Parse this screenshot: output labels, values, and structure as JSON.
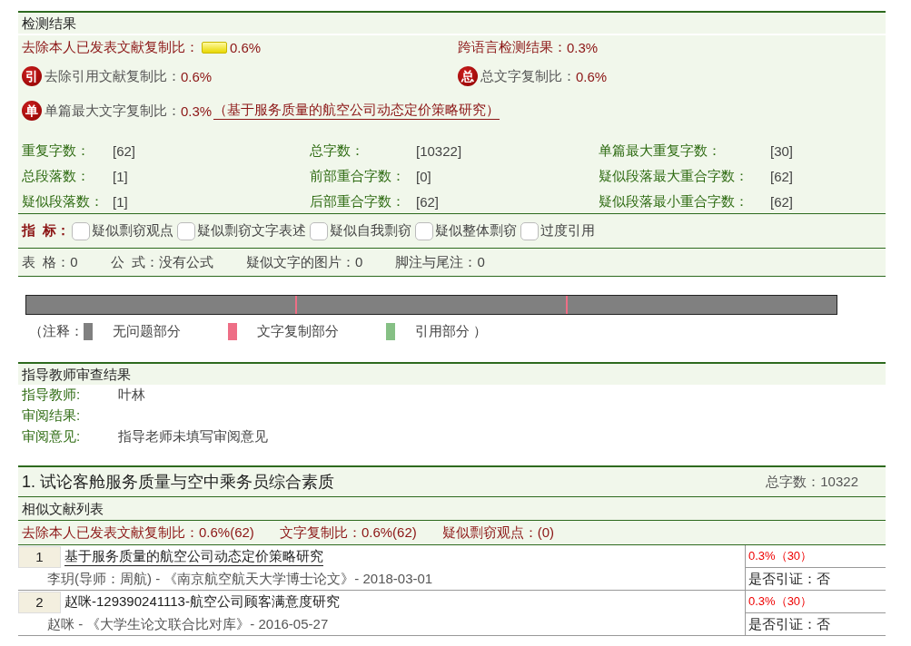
{
  "result_section": {
    "title": "检测结果",
    "summary": [
      {
        "kind": "bar",
        "label": "去除本人已发表文献复制比：",
        "value": "0.6%"
      },
      {
        "kind": "plain",
        "label": "跨语言检测结果：",
        "value": "0.3%"
      },
      {
        "kind": "seal",
        "seal": "引",
        "label": "去除引用文献复制比：",
        "value": "0.6%"
      },
      {
        "kind": "seal",
        "seal": "总",
        "label": "总文字复制比：",
        "value": "0.6%"
      },
      {
        "kind": "seal",
        "seal": "单",
        "label": "单篇最大文字复制比：",
        "value": "0.3%",
        "link": "（基于服务质量的航空公司动态定价策略研究）"
      }
    ],
    "stats": [
      {
        "label": "重复字数：",
        "value": "[62]"
      },
      {
        "label": "总字数：",
        "value": "[10322]"
      },
      {
        "label": "单篇最大重复字数：",
        "value": "[30]"
      },
      {
        "label": "总段落数：",
        "value": "[1]"
      },
      {
        "label": "前部重合字数：",
        "value": "[0]"
      },
      {
        "label": "疑似段落最大重合字数：",
        "value": "[62]"
      },
      {
        "label": "疑似段落数：",
        "value": "[1]"
      },
      {
        "label": "后部重合字数：",
        "value": "[62]"
      },
      {
        "label": "疑似段落最小重合字数：",
        "value": "[62]"
      }
    ],
    "indicators": {
      "label": "指  标：",
      "options": [
        {
          "label": "疑似剽窃观点",
          "checked": false
        },
        {
          "label": "疑似剽窃文字表述",
          "checked": false
        },
        {
          "label": "疑似自我剽窃",
          "checked": false
        },
        {
          "label": "疑似整体剽窃",
          "checked": false
        },
        {
          "label": "过度引用",
          "checked": false
        }
      ]
    },
    "misc": [
      {
        "label": "表  格：",
        "value": "0"
      },
      {
        "label": "公  式：",
        "value": "没有公式"
      },
      {
        "label": "疑似文字的图片：",
        "value": "0"
      },
      {
        "label": "脚注与尾注：",
        "value": "0"
      }
    ],
    "distribution": [
      {
        "kind": "ok"
      },
      {
        "kind": "copy"
      },
      {
        "kind": "ok"
      },
      {
        "kind": "copy"
      },
      {
        "kind": "ok"
      }
    ],
    "legend": {
      "open": "（注释：",
      "close": "）",
      "items": [
        {
          "label": "无问题部分",
          "color": "#808080"
        },
        {
          "label": "文字复制部分",
          "color": "#ee6e86"
        },
        {
          "label": "引用部分",
          "color": "#86c085"
        }
      ]
    }
  },
  "teacher_section": {
    "title": "指导教师审查结果",
    "rows": [
      {
        "label": "指导教师:",
        "value": "叶林"
      },
      {
        "label": "审阅结果:"
      },
      {
        "label": "审阅意见:",
        "value": "指导老师未填写审阅意见"
      }
    ]
  },
  "document_section": {
    "title": "1. 试论客舱服务质量与空中乘务员综合素质",
    "word_count": "总字数：10322",
    "subtitle": "相似文献列表",
    "stats": [
      {
        "label": "去除本人已发表文献复制比：",
        "value": "0.6%(62)"
      },
      {
        "label": "文字复制比：",
        "value": "0.6%(62)"
      },
      {
        "label": "疑似剽窃观点：",
        "value": "(0)"
      }
    ],
    "sources": [
      {
        "number": "1",
        "title": "基于服务质量的航空公司动态定价策略研究",
        "underlined": true,
        "meta": "李玥(导师：周航) - 《南京航空航天大学博士论文》- 2018-03-01",
        "ratio": "0.3%（30）",
        "cited": "是否引证：否"
      },
      {
        "number": "2",
        "title": "赵咪-129390241113-航空公司顾客满意度研究",
        "underlined": false,
        "meta": "赵咪 - 《大学生论文联合比对库》- 2016-05-27",
        "ratio": "0.3%（30）",
        "cited": "是否引证：否"
      }
    ]
  }
}
